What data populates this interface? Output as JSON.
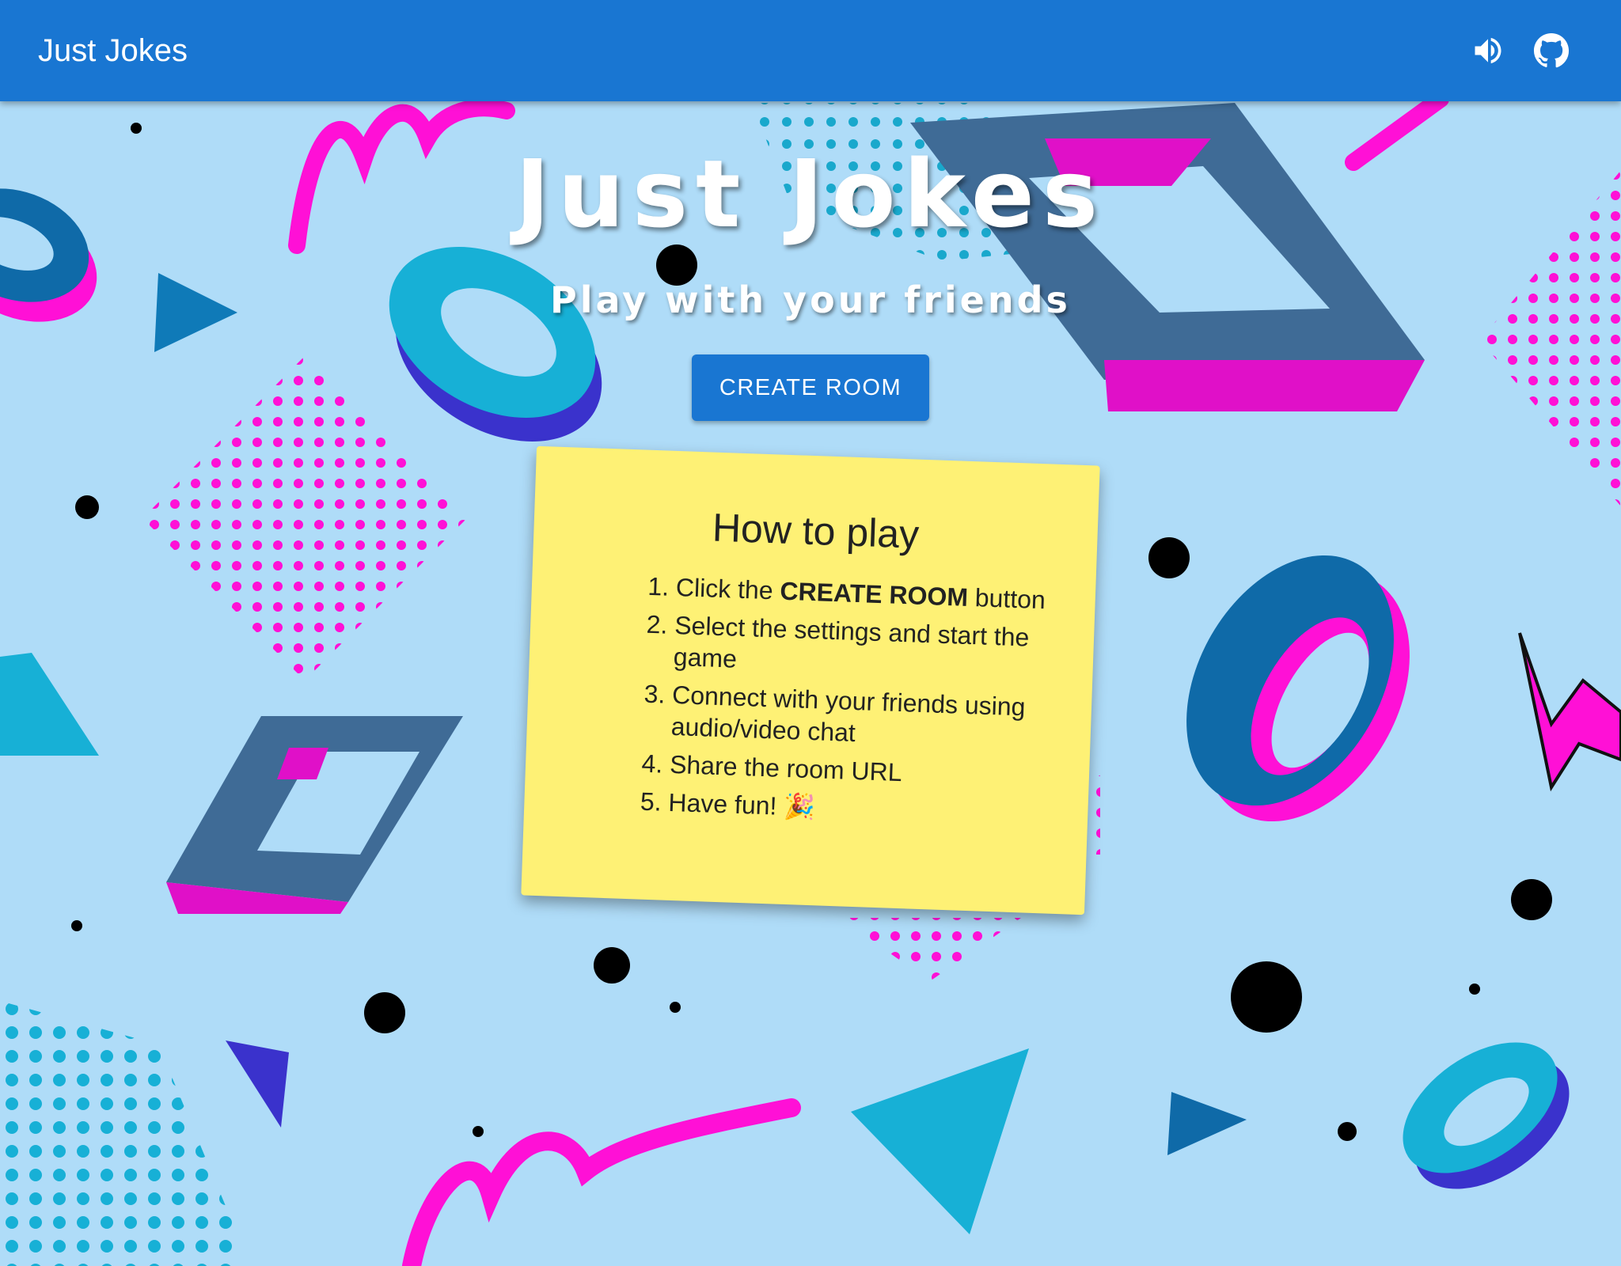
{
  "appbar": {
    "title": "Just Jokes",
    "volume_icon": "volume-up-icon",
    "github_icon": "github-icon"
  },
  "hero": {
    "title": "Just Jokes",
    "subtitle": "Play with your friends",
    "create_button": "CREATE ROOM"
  },
  "how_to_play": {
    "heading": "How to play",
    "steps": [
      {
        "before": "Click the ",
        "bold": "CREATE ROOM",
        "after": " button"
      },
      {
        "before": "Select the settings and start the game",
        "bold": "",
        "after": ""
      },
      {
        "before": "Connect with your friends using audio/video chat",
        "bold": "",
        "after": ""
      },
      {
        "before": "Share the room URL",
        "bold": "",
        "after": ""
      },
      {
        "before": "Have fun! ",
        "bold": "",
        "after": "🎉"
      }
    ]
  },
  "colors": {
    "appbar": "#1976d2",
    "background": "#afdcf8",
    "note": "#fef175",
    "magenta": "#ff10d6",
    "cyan": "#17b0d6",
    "blue": "#0f6aa8",
    "indigo": "#3a32cc"
  }
}
